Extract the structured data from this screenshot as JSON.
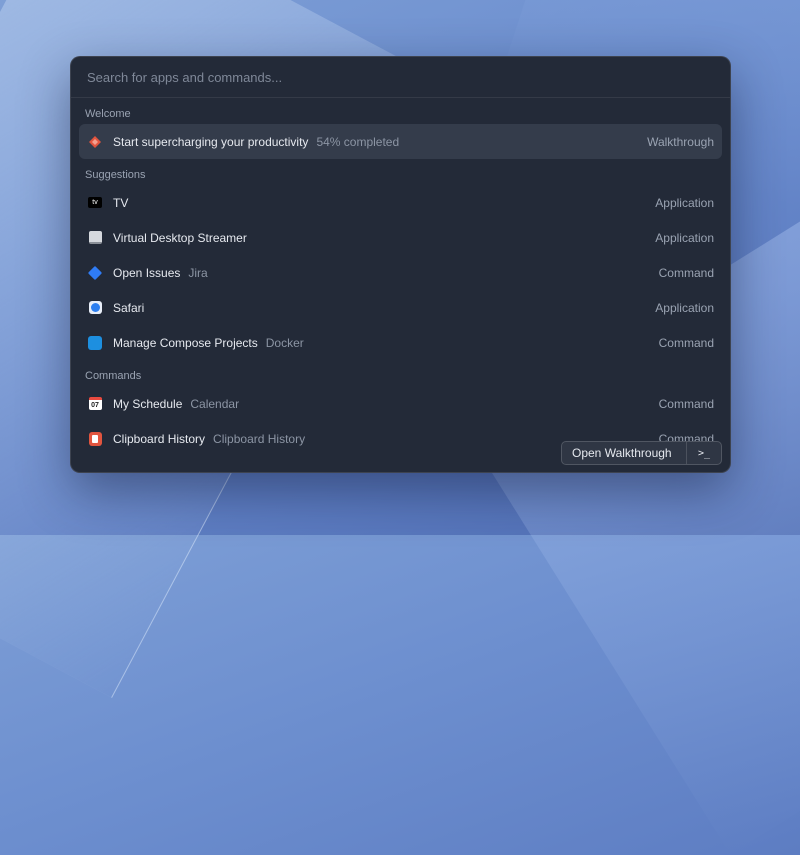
{
  "search": {
    "placeholder": "Search for apps and commands..."
  },
  "sections": {
    "welcome": "Welcome",
    "suggestions": "Suggestions",
    "commands": "Commands"
  },
  "welcome_item": {
    "title": "Start supercharging your productivity",
    "progress": "54% completed",
    "type": "Walkthrough",
    "icon": "raycast-logo-icon"
  },
  "suggestions": [
    {
      "title": "TV",
      "sub": "",
      "type": "Application",
      "icon": "apple-tv-icon"
    },
    {
      "title": "Virtual Desktop Streamer",
      "sub": "",
      "type": "Application",
      "icon": "monitor-icon"
    },
    {
      "title": "Open Issues",
      "sub": "Jira",
      "type": "Command",
      "icon": "jira-icon"
    },
    {
      "title": "Safari",
      "sub": "",
      "type": "Application",
      "icon": "safari-icon"
    },
    {
      "title": "Manage Compose Projects",
      "sub": "Docker",
      "type": "Command",
      "icon": "docker-icon"
    }
  ],
  "commands": [
    {
      "title": "My Schedule",
      "sub": "Calendar",
      "type": "Command",
      "icon": "calendar-icon",
      "icon_text": "07"
    },
    {
      "title": "Clipboard History",
      "sub": "Clipboard History",
      "type": "Command",
      "icon": "clipboard-icon"
    }
  ],
  "action_bar": {
    "primary": "Open Walkthrough",
    "secondary": ">_"
  },
  "colors": {
    "accent": "#e2553f",
    "window_bg": "#232a38",
    "selected_bg": "#343c4b"
  }
}
